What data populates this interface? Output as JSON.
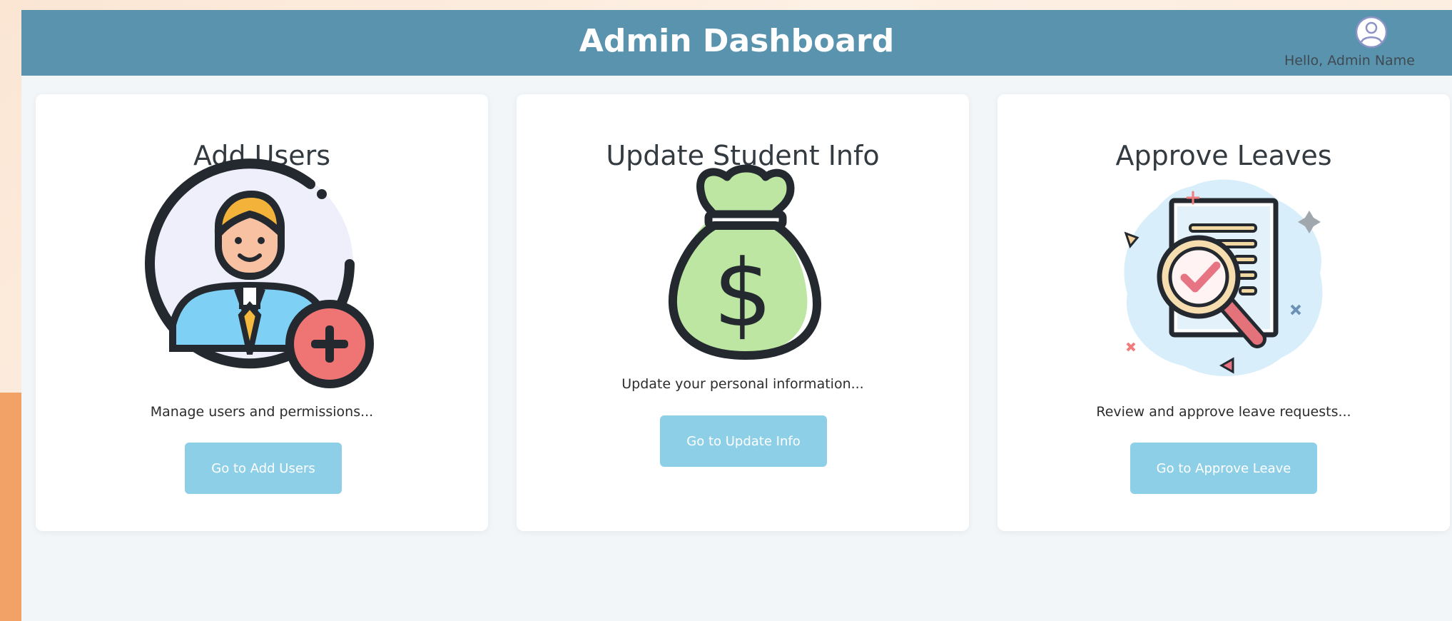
{
  "header": {
    "title": "Admin Dashboard",
    "greeting": "Hello, Admin Name",
    "avatar_icon": "user-avatar-icon"
  },
  "cards": [
    {
      "title": "Add Users",
      "description": "Manage users and permissions...",
      "button_label": "Go to Add Users",
      "icon": "add-user-icon"
    },
    {
      "title": "Update Student Info",
      "description": "Update your personal information...",
      "button_label": "Go to Update Info",
      "icon": "money-bag-icon"
    },
    {
      "title": "Approve Leaves",
      "description": "Review and approve leave requests...",
      "button_label": "Go to Approve Leave",
      "icon": "document-review-icon"
    }
  ],
  "colors": {
    "header": "#5993ad",
    "button": "#8dcfe7",
    "page_background": "#f3f6f9",
    "accent_bar": "#f2a267"
  }
}
